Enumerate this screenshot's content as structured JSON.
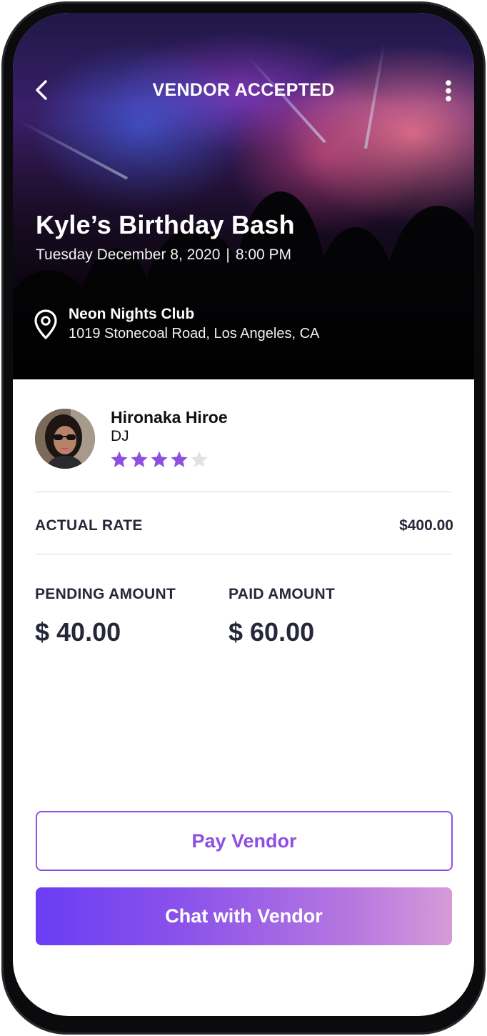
{
  "header": {
    "title": "VENDOR ACCEPTED",
    "back_icon": "chevron-left-icon",
    "more_icon": "more-vertical-icon"
  },
  "event": {
    "title": "Kyle’s Birthday Bash",
    "date": "Tuesday December 8, 2020",
    "separator": "|",
    "time": "8:00 PM",
    "venue_name": "Neon Nights Club",
    "venue_address": "1019 Stonecoal Road, Los Angeles, CA",
    "location_icon": "location-pin-icon"
  },
  "vendor": {
    "name": "Hironaka Hiroe",
    "role": "DJ",
    "rating": 4,
    "rating_max": 5
  },
  "rates": {
    "actual_rate_label": "ACTUAL RATE",
    "actual_rate_value": "$400.00",
    "pending_label": "PENDING AMOUNT",
    "pending_value": "$ 40.00",
    "paid_label": "PAID AMOUNT",
    "paid_value": "$ 60.00"
  },
  "actions": {
    "pay_label": "Pay Vendor",
    "chat_label": "Chat with Vendor"
  },
  "colors": {
    "accent": "#8e4fe0",
    "star_filled": "#8e4fe0",
    "star_empty": "#e2e2e6",
    "text_dark": "#26283a"
  }
}
